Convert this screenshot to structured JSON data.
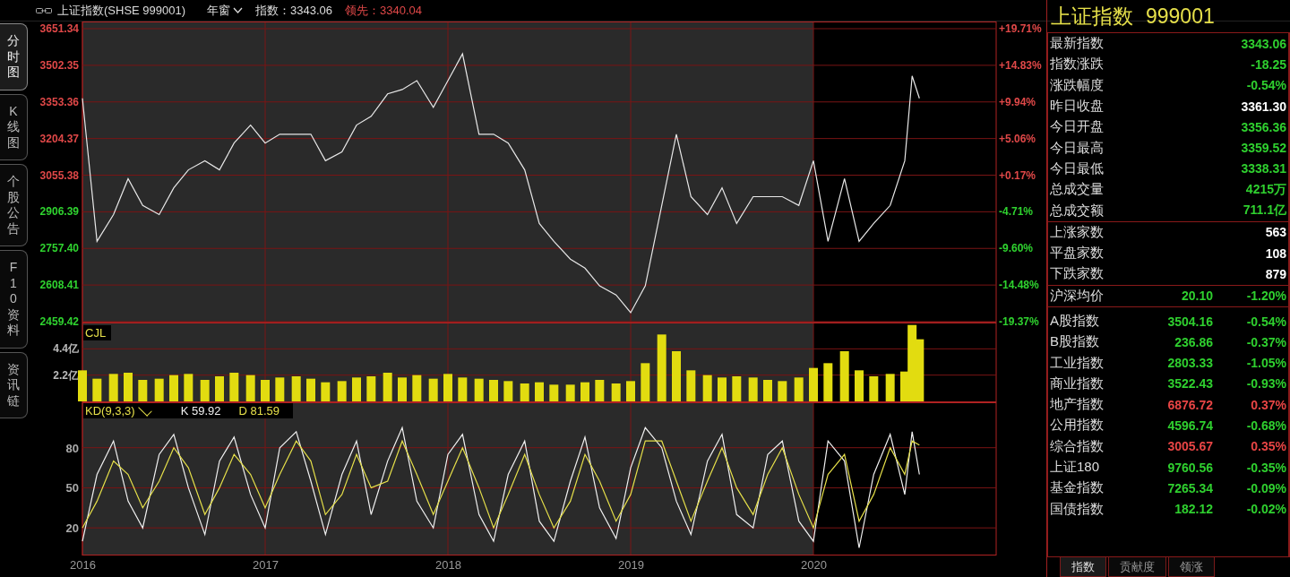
{
  "header": {
    "title": "上证指数(SHSE 999001)",
    "period": "年窗",
    "index_label": "指数：3343.06",
    "lead_label": "领先：3340.04"
  },
  "side_tabs": [
    {
      "label": "分时图",
      "selected": true
    },
    {
      "label": "K线图",
      "selected": false
    },
    {
      "label": "个股公告",
      "selected": false
    },
    {
      "label": "F10资料",
      "selected": false
    },
    {
      "label": "资讯链",
      "selected": false
    }
  ],
  "price_chart": {
    "percent_axis": [
      {
        "label": "+19.71%",
        "up": true
      },
      {
        "label": "+14.83%",
        "up": true
      },
      {
        "label": "+9.94%",
        "up": true
      },
      {
        "label": "+5.06%",
        "up": true
      },
      {
        "label": "+0.17%",
        "up": true
      },
      {
        "label": "-4.71%",
        "up": false
      },
      {
        "label": "-9.60%",
        "up": false
      },
      {
        "label": "-14.48%",
        "up": false
      },
      {
        "label": "-19.37%",
        "up": false
      }
    ],
    "chart_data": {
      "type": "line",
      "grid": true,
      "xlim": [
        2016,
        2021
      ],
      "ylim": [
        2459.42,
        3651.34
      ],
      "yticks": [
        {
          "value": 3651.34,
          "label": "3651.34"
        },
        {
          "value": 3502.35,
          "label": "3502.35"
        },
        {
          "value": 3353.36,
          "label": "3353.36"
        },
        {
          "value": 3204.37,
          "label": "3204.37"
        },
        {
          "value": 3055.38,
          "label": "3055.38"
        },
        {
          "value": 2906.39,
          "label": "2906.39"
        },
        {
          "value": 2757.4,
          "label": "2757.40"
        },
        {
          "value": 2608.41,
          "label": "2608.41"
        },
        {
          "value": 2459.42,
          "label": "2459.42"
        }
      ],
      "x": [
        2016.0,
        2016.08,
        2016.17,
        2016.25,
        2016.33,
        2016.42,
        2016.5,
        2016.58,
        2016.67,
        2016.75,
        2016.83,
        2016.92,
        2017.0,
        2017.08,
        2017.17,
        2017.25,
        2017.33,
        2017.42,
        2017.5,
        2017.58,
        2017.67,
        2017.75,
        2017.83,
        2017.92,
        2018.0,
        2018.08,
        2018.17,
        2018.25,
        2018.33,
        2018.42,
        2018.5,
        2018.58,
        2018.67,
        2018.75,
        2018.83,
        2018.92,
        2019.0,
        2019.08,
        2019.17,
        2019.25,
        2019.33,
        2019.42,
        2019.5,
        2019.58,
        2019.67,
        2019.75,
        2019.83,
        2019.92,
        2020.0,
        2020.08,
        2020.17,
        2020.25,
        2020.33,
        2020.42,
        2020.5,
        2020.54,
        2020.58
      ],
      "series": [
        {
          "color": "#e8e8e8",
          "values": [
            3368,
            2786,
            2895,
            3041,
            2932,
            2895,
            3004,
            3077,
            3114,
            3077,
            3186,
            3259,
            3186,
            3222,
            3222,
            3222,
            3114,
            3150,
            3259,
            3295,
            3386,
            3404,
            3440,
            3331,
            3440,
            3549,
            3222,
            3222,
            3186,
            3077,
            2859,
            2786,
            2714,
            2677,
            2605,
            2568,
            2496,
            2605,
            2932,
            3222,
            2968,
            2895,
            3004,
            2859,
            2968,
            2968,
            2968,
            2932,
            3114,
            2786,
            3041,
            2786,
            2859,
            2932,
            3114,
            3459,
            3368
          ]
        }
      ]
    }
  },
  "volume_chart": {
    "chart_data": {
      "type": "bar",
      "grid": true,
      "xlim": [
        2016,
        2021
      ],
      "ylim": [
        0,
        6.6
      ],
      "yticks": [
        {
          "value": 4.4,
          "label": "4.4亿"
        },
        {
          "value": 2.2,
          "label": "2.2亿"
        }
      ],
      "x": [
        2016.0,
        2016.08,
        2016.17,
        2016.25,
        2016.33,
        2016.42,
        2016.5,
        2016.58,
        2016.67,
        2016.75,
        2016.83,
        2016.92,
        2017.0,
        2017.08,
        2017.17,
        2017.25,
        2017.33,
        2017.42,
        2017.5,
        2017.58,
        2017.67,
        2017.75,
        2017.83,
        2017.92,
        2018.0,
        2018.08,
        2018.17,
        2018.25,
        2018.33,
        2018.42,
        2018.5,
        2018.58,
        2018.67,
        2018.75,
        2018.83,
        2018.92,
        2019.0,
        2019.08,
        2019.17,
        2019.25,
        2019.33,
        2019.42,
        2019.5,
        2019.58,
        2019.67,
        2019.75,
        2019.83,
        2019.92,
        2020.0,
        2020.08,
        2020.17,
        2020.25,
        2020.33,
        2020.42,
        2020.5,
        2020.54,
        2020.58
      ],
      "series": [
        {
          "name": "CJL",
          "color": "#e2dc10",
          "values": [
            2.6,
            1.9,
            2.3,
            2.4,
            1.8,
            1.9,
            2.2,
            2.3,
            1.8,
            2.1,
            2.4,
            2.2,
            1.8,
            2.0,
            2.1,
            1.9,
            1.6,
            1.7,
            2.0,
            2.1,
            2.4,
            2.0,
            2.2,
            1.9,
            2.3,
            2.0,
            1.9,
            1.8,
            1.7,
            1.5,
            1.6,
            1.4,
            1.4,
            1.6,
            1.8,
            1.5,
            1.7,
            3.2,
            5.6,
            4.2,
            2.6,
            2.2,
            2.0,
            2.1,
            2.0,
            1.8,
            1.7,
            2.0,
            2.8,
            3.2,
            4.2,
            2.6,
            2.1,
            2.3,
            2.5,
            6.4,
            5.2
          ]
        }
      ]
    }
  },
  "kd_chart": {
    "title": "KD(9,3,3)",
    "k_reading": "59.92",
    "d_reading": "81.59",
    "chart_data": {
      "type": "line",
      "grid": true,
      "xlim": [
        2016,
        2021
      ],
      "ylim": [
        0,
        114
      ],
      "xticks": [
        2016,
        2017,
        2018,
        2019,
        2020
      ],
      "yticks": [
        80,
        50,
        20
      ],
      "x": [
        2016.0,
        2016.08,
        2016.17,
        2016.25,
        2016.33,
        2016.42,
        2016.5,
        2016.58,
        2016.67,
        2016.75,
        2016.83,
        2016.92,
        2017.0,
        2017.08,
        2017.17,
        2017.25,
        2017.33,
        2017.42,
        2017.5,
        2017.58,
        2017.67,
        2017.75,
        2017.83,
        2017.92,
        2018.0,
        2018.08,
        2018.17,
        2018.25,
        2018.33,
        2018.42,
        2018.5,
        2018.58,
        2018.67,
        2018.75,
        2018.83,
        2018.92,
        2019.0,
        2019.08,
        2019.17,
        2019.25,
        2019.33,
        2019.42,
        2019.5,
        2019.58,
        2019.67,
        2019.75,
        2019.83,
        2019.92,
        2020.0,
        2020.08,
        2020.17,
        2020.25,
        2020.33,
        2020.42,
        2020.5,
        2020.54,
        2020.58
      ],
      "series": [
        {
          "name": "K",
          "color": "#f0f0f0",
          "values": [
            10,
            60,
            85,
            40,
            20,
            75,
            90,
            50,
            15,
            70,
            88,
            45,
            20,
            80,
            92,
            55,
            15,
            60,
            85,
            30,
            70,
            95,
            40,
            20,
            75,
            90,
            30,
            10,
            60,
            85,
            25,
            10,
            55,
            88,
            35,
            12,
            65,
            95,
            80,
            40,
            15,
            70,
            90,
            30,
            20,
            75,
            85,
            25,
            10,
            85,
            70,
            5,
            60,
            90,
            45,
            92,
            60
          ]
        },
        {
          "name": "D",
          "color": "#e6e04a",
          "values": [
            20,
            40,
            70,
            60,
            35,
            55,
            80,
            65,
            30,
            50,
            75,
            60,
            35,
            60,
            85,
            70,
            30,
            45,
            75,
            50,
            55,
            85,
            60,
            30,
            55,
            80,
            50,
            20,
            45,
            75,
            45,
            20,
            40,
            75,
            55,
            25,
            45,
            85,
            85,
            55,
            25,
            55,
            80,
            50,
            30,
            60,
            80,
            45,
            20,
            60,
            75,
            25,
            45,
            80,
            60,
            85,
            82
          ]
        }
      ]
    }
  },
  "quote_panel": {
    "title": "上证指数",
    "code": "999001",
    "quote_rows": [
      {
        "label": "最新指数",
        "value": "3343.06",
        "color": "#2fd02f"
      },
      {
        "label": "指数涨跌",
        "value": "-18.25",
        "color": "#2fd02f"
      },
      {
        "label": "涨跌幅度",
        "value": "-0.54%",
        "color": "#2fd02f"
      },
      {
        "label": "昨日收盘",
        "value": "3361.30",
        "color": "#ffffff"
      },
      {
        "label": "今日开盘",
        "value": "3356.36",
        "color": "#2fd02f"
      },
      {
        "label": "今日最高",
        "value": "3359.52",
        "color": "#2fd02f"
      },
      {
        "label": "今日最低",
        "value": "3338.31",
        "color": "#2fd02f"
      },
      {
        "label": "总成交量",
        "value": "4215万",
        "color": "#2fd02f"
      },
      {
        "label": "总成交额",
        "value": "711.1亿",
        "color": "#2fd02f"
      }
    ],
    "breadth_rows": [
      {
        "label": "上涨家数",
        "value": "563"
      },
      {
        "label": "平盘家数",
        "value": "108"
      },
      {
        "label": "下跌家数",
        "value": "879"
      }
    ],
    "average_row": {
      "label": "沪深均价",
      "value": "20.10",
      "change": "-1.20%",
      "color": "#2fd02f"
    },
    "index_rows": [
      {
        "label": "A股指数",
        "value": "3504.16",
        "change": "-0.54%",
        "color": "#2fd02f"
      },
      {
        "label": "B股指数",
        "value": "236.86",
        "change": "-0.37%",
        "color": "#2fd02f"
      },
      {
        "label": "工业指数",
        "value": "2803.33",
        "change": "-1.05%",
        "color": "#2fd02f"
      },
      {
        "label": "商业指数",
        "value": "3522.43",
        "change": "-0.93%",
        "color": "#2fd02f"
      },
      {
        "label": "地产指数",
        "value": "6876.72",
        "change": "0.37%",
        "color": "#e84545"
      },
      {
        "label": "公用指数",
        "value": "4596.74",
        "change": "-0.68%",
        "color": "#2fd02f"
      },
      {
        "label": "综合指数",
        "value": "3005.67",
        "change": "0.35%",
        "color": "#e84545"
      },
      {
        "label": "上证180",
        "value": "9760.56",
        "change": "-0.35%",
        "color": "#2fd02f"
      },
      {
        "label": "基金指数",
        "value": "7265.34",
        "change": "-0.09%",
        "color": "#2fd02f"
      },
      {
        "label": "国债指数",
        "value": "182.12",
        "change": "-0.02%",
        "color": "#2fd02f"
      }
    ],
    "tabs": [
      {
        "label": "指数",
        "selected": true
      },
      {
        "label": "贡献度",
        "selected": false
      },
      {
        "label": "领涨",
        "selected": false
      }
    ]
  }
}
